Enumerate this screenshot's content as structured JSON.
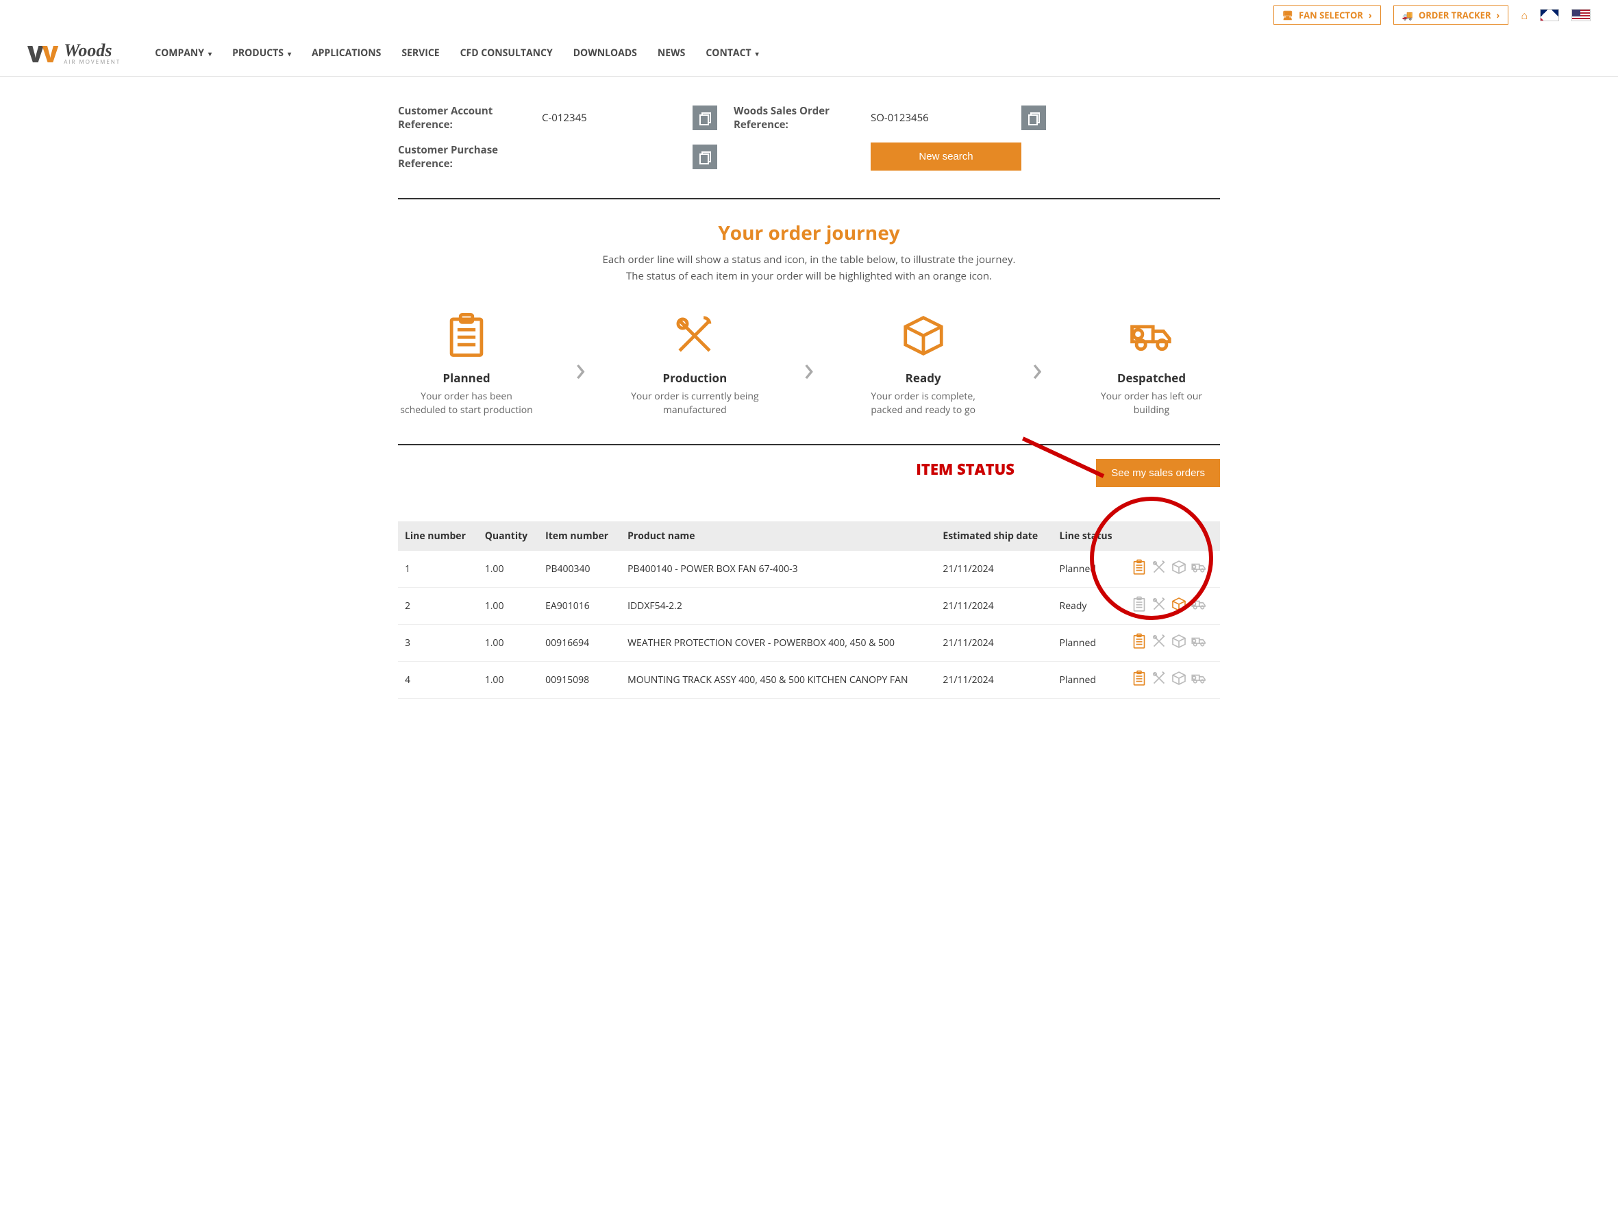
{
  "top": {
    "fan_selector": "FAN SELECTOR",
    "order_tracker": "ORDER TRACKER"
  },
  "nav": {
    "company": "COMPANY",
    "products": "PRODUCTS",
    "applications": "APPLICATIONS",
    "service": "SERVICE",
    "cfd": "CFD CONSULTANCY",
    "downloads": "DOWNLOADS",
    "news": "NEWS",
    "contact": "CONTACT"
  },
  "logo": {
    "brand": "Woods",
    "tagline": "AIR MOVEMENT"
  },
  "refs": {
    "cust_acct_label": "Customer Account Reference:",
    "cust_acct_value": "C-012345",
    "sales_order_label": "Woods Sales Order Reference:",
    "sales_order_value": "SO-0123456",
    "cust_purchase_label": "Customer Purchase Reference:",
    "new_search": "New search"
  },
  "journey": {
    "title": "Your order journey",
    "sub1": "Each order line will show a status and icon, in the table below, to illustrate the journey.",
    "sub2": "The status of each item in your order will be highlighted with an orange icon.",
    "stages": [
      {
        "title": "Planned",
        "desc": "Your order has been scheduled to start production"
      },
      {
        "title": "Production",
        "desc": "Your order is currently being manufactured"
      },
      {
        "title": "Ready",
        "desc": "Your order is complete, packed and ready to go"
      },
      {
        "title": "Despatched",
        "desc": "Your order has left our building"
      }
    ]
  },
  "callout": {
    "item_status": "ITEM STATUS",
    "see_orders": "See my sales orders"
  },
  "table": {
    "headers": {
      "line": "Line number",
      "qty": "Quantity",
      "item": "Item number",
      "product": "Product name",
      "ship": "Estimated ship date",
      "status": "Line status"
    },
    "rows": [
      {
        "line": "1",
        "qty": "1.00",
        "item": "PB400340",
        "product": "PB400140 - POWER BOX FAN 67-400-3",
        "ship": "21/11/2024",
        "status": "Planned",
        "active_idx": 0
      },
      {
        "line": "2",
        "qty": "1.00",
        "item": "EA901016",
        "product": "IDDXF54-2.2",
        "ship": "21/11/2024",
        "status": "Ready",
        "active_idx": 2
      },
      {
        "line": "3",
        "qty": "1.00",
        "item": "00916694",
        "product": "WEATHER PROTECTION COVER - POWERBOX 400, 450 & 500",
        "ship": "21/11/2024",
        "status": "Planned",
        "active_idx": 0
      },
      {
        "line": "4",
        "qty": "1.00",
        "item": "00915098",
        "product": "MOUNTING TRACK ASSY 400, 450 & 500 KITCHEN CANOPY FAN",
        "ship": "21/11/2024",
        "status": "Planned",
        "active_idx": 0
      }
    ]
  }
}
